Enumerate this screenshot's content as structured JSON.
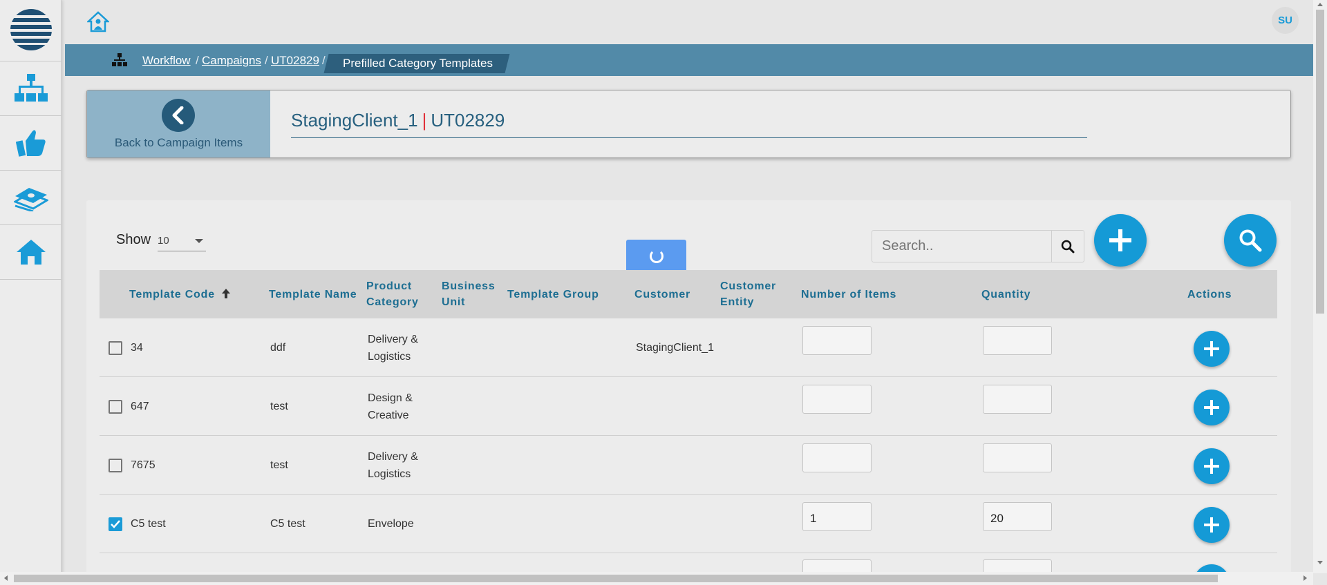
{
  "user": {
    "initials": "SU"
  },
  "breadcrumb": {
    "items": [
      "Workflow",
      "Campaigns",
      "UT02829"
    ],
    "current": "Prefilled Category Templates",
    "separator": "/"
  },
  "header": {
    "back_label": "Back to Campaign Items",
    "client": "StagingClient_1",
    "separator": "|",
    "campaign": "UT02829"
  },
  "controls": {
    "show_label": "Show",
    "page_size": "10",
    "search_placeholder": "Search.."
  },
  "table": {
    "columns": {
      "template_code": "Template Code",
      "template_name": "Template Name",
      "product_category": [
        "Product",
        "Category"
      ],
      "business_unit": [
        "Business",
        "Unit"
      ],
      "template_group": "Template Group",
      "customer": "Customer",
      "customer_entity": [
        "Customer",
        "Entity"
      ],
      "number_of_items": "Number of Items",
      "quantity": "Quantity",
      "actions": "Actions"
    },
    "rows": [
      {
        "checked": false,
        "code": "34",
        "name": "ddf",
        "category": [
          "Delivery &",
          "Logistics"
        ],
        "customer": "StagingClient_1",
        "items": "",
        "quantity": ""
      },
      {
        "checked": false,
        "code": "647",
        "name": "test",
        "category": [
          "Design &",
          "Creative"
        ],
        "customer": "",
        "items": "",
        "quantity": ""
      },
      {
        "checked": false,
        "code": "7675",
        "name": "test",
        "category": [
          "Delivery &",
          "Logistics"
        ],
        "customer": "",
        "items": "",
        "quantity": ""
      },
      {
        "checked": true,
        "code": "C5 test",
        "name": "C5 test",
        "category": [
          "Envelope"
        ],
        "customer": "",
        "items": "1",
        "quantity": "20"
      }
    ]
  },
  "colors": {
    "accent": "#159ad6",
    "breadcrumb_bar": "#528aa8",
    "header_text": "#27607f",
    "title_separator": "#e0303a"
  }
}
